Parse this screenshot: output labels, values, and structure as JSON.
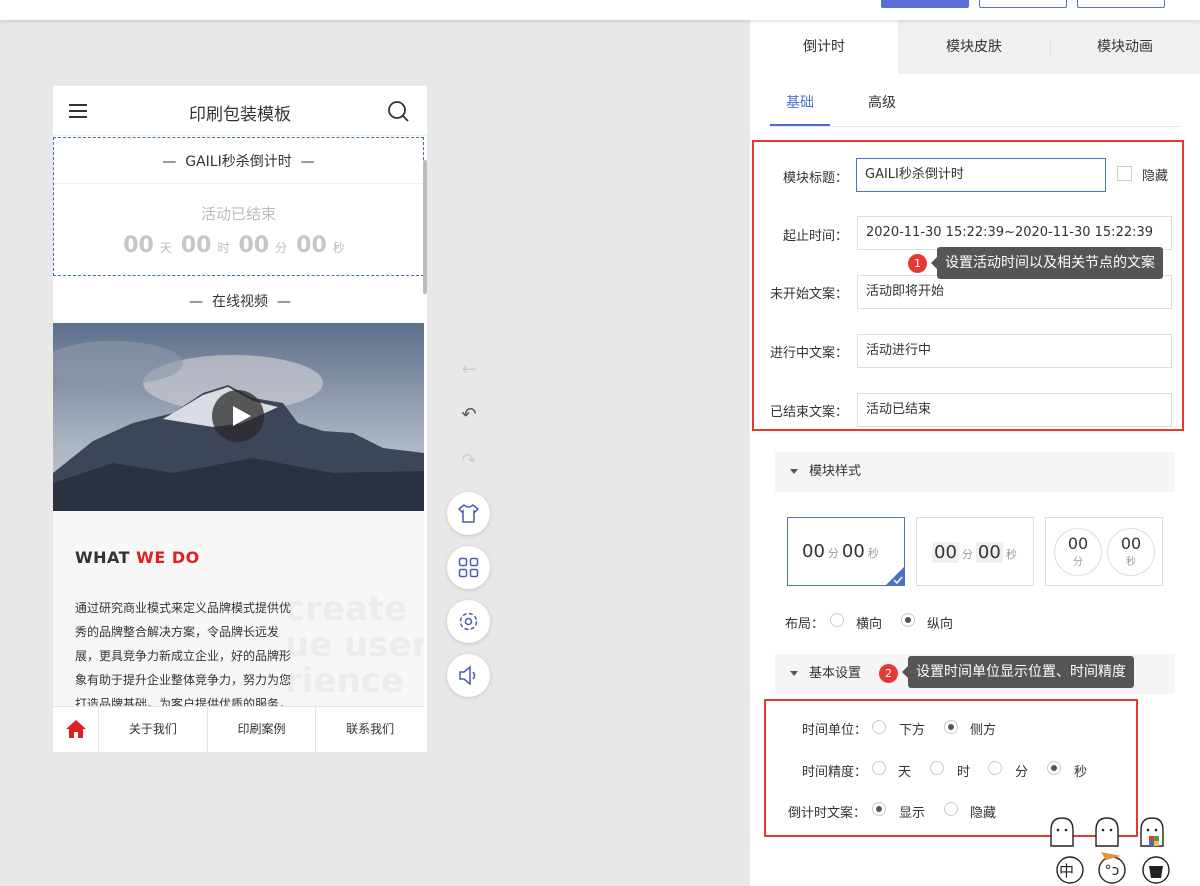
{
  "phone": {
    "title": "印刷包装模板",
    "countdown": {
      "title": "GAILI秒杀倒计时",
      "status": "活动已结束",
      "days": "00",
      "day_unit": "天",
      "hours": "00",
      "hour_unit": "时",
      "minutes": "00",
      "minute_unit": "分",
      "seconds": "00",
      "second_unit": "秒"
    },
    "video_title": "在线视频",
    "what": {
      "prefix": "WHAT",
      "highlight": "WE DO",
      "body": "通过研究商业模式来定义品牌模式提供优秀的品牌整合解决方案，令品牌长远发展，更具竞争力新成立企业，好的品牌形象有助于提升企业整体竞争力，努力为您打造品牌基础。为客户提供优质的服务，",
      "bg_line1": "create",
      "bg_line2": "ue user",
      "bg_line3": "rience"
    },
    "bottom_nav": [
      "关于我们",
      "印刷案例",
      "联系我们"
    ]
  },
  "tools": {
    "back_arrow": "←",
    "undo_arrow": "↶",
    "redo_arrow": "↷"
  },
  "panel": {
    "tabs": [
      "倒计时",
      "模块皮肤",
      "模块动画"
    ],
    "sub_tabs": [
      "基础",
      "高级"
    ],
    "fields": {
      "title_label": "模块标题：",
      "title_value": "GAILI秒杀倒计时",
      "hide_label": "隐藏",
      "time_label": "起止时间：",
      "time_value": "2020-11-30 15:22:39~2020-11-30 15:22:39",
      "not_started_label": "未开始文案：",
      "not_started_value": "活动即将开始",
      "in_progress_label": "进行中文案：",
      "in_progress_value": "活动进行中",
      "ended_label": "已结束文案：",
      "ended_value": "活动已结束"
    },
    "tip1": {
      "badge": "1",
      "text": "设置活动时间以及相关节点的文案"
    },
    "tip2": {
      "badge": "2",
      "text": "设置时间单位显示位置、时间精度"
    },
    "style_section": "模块样式",
    "style_cards": {
      "c1": {
        "m": "00",
        "mu": "分",
        "s": "00",
        "su": "秒"
      },
      "c2": {
        "m": "00",
        "mu": "分",
        "s": "00",
        "su": "秒"
      },
      "c3": {
        "m": "00",
        "mu": "分",
        "s": "00",
        "su": "秒"
      }
    },
    "layout": {
      "label": "布局：",
      "options": [
        "横向",
        "纵向"
      ],
      "selected": "纵向"
    },
    "basic_section": "基本设置",
    "time_unit": {
      "label": "时间单位：",
      "options": [
        "下方",
        "侧方"
      ],
      "selected": "侧方"
    },
    "precision": {
      "label": "时间精度：",
      "options": [
        "天",
        "时",
        "分",
        "秒"
      ],
      "selected": "秒"
    },
    "cd_text": {
      "label": "倒计时文案：",
      "options": [
        "显示",
        "隐藏"
      ],
      "selected": "显示"
    },
    "mascot_char": "中"
  },
  "colors": {
    "accent": "#4a70c8",
    "annotation_red": "#e53935",
    "brand_red": "#e02020"
  }
}
